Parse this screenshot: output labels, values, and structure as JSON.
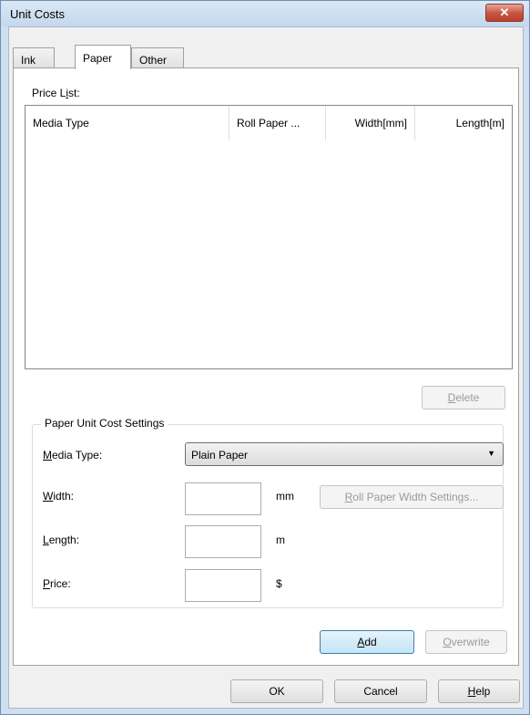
{
  "window": {
    "title": "Unit Costs",
    "close_glyph": "✕"
  },
  "tabs": [
    {
      "label": "Ink"
    },
    {
      "label": "Paper"
    },
    {
      "label": "Other"
    }
  ],
  "price_list": {
    "label_pre": "Price L",
    "label_acc": "i",
    "label_post": "st:",
    "columns": [
      "Media Type",
      "Roll Paper ...",
      "Width[mm]",
      "Length[m]"
    ],
    "rows": []
  },
  "delete_button": {
    "acc": "D",
    "rest": "elete"
  },
  "settings": {
    "group_label": "Paper Unit Cost Settings",
    "media_type": {
      "acc": "M",
      "rest": "edia Type:",
      "value": "Plain Paper"
    },
    "width": {
      "acc": "W",
      "rest": "idth:",
      "value": "",
      "unit": "mm"
    },
    "roll_button": {
      "acc": "R",
      "rest": "oll Paper Width Settings..."
    },
    "length": {
      "acc": "L",
      "rest": "ength:",
      "value": "",
      "unit": "m"
    },
    "price": {
      "acc": "P",
      "rest": "rice:",
      "value": "",
      "unit": "$"
    }
  },
  "add_button": {
    "acc": "A",
    "rest": "dd"
  },
  "overwrite_button": {
    "acc": "O",
    "rest": "verwrite"
  },
  "footer": {
    "ok": "OK",
    "cancel": "Cancel",
    "help": {
      "acc": "H",
      "rest": "elp"
    }
  }
}
